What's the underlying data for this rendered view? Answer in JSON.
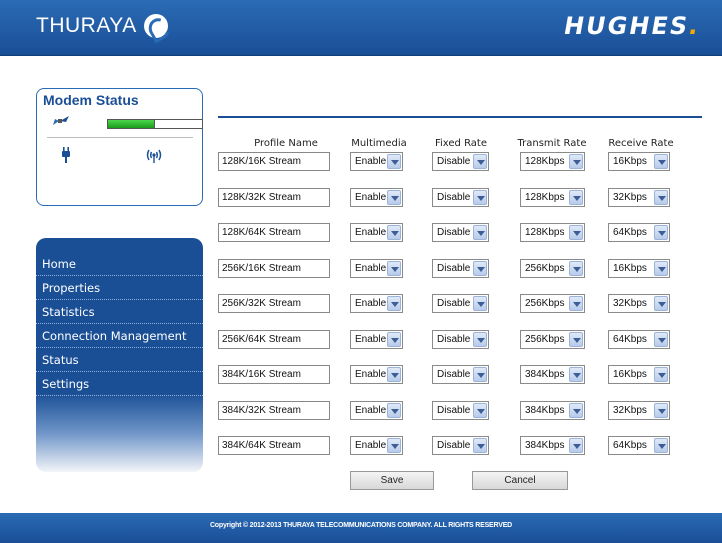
{
  "header": {
    "brand_left": "THURAYA",
    "brand_right": "HUGHES",
    "brand_right_dot": "."
  },
  "status_box": {
    "title": "Modem Status",
    "signal_level": 0.5
  },
  "nav": {
    "items": [
      "Home",
      "Properties",
      "Statistics",
      "Connection Management",
      "Status",
      "Settings"
    ]
  },
  "table": {
    "headers": [
      "Profile Name",
      "Multimedia",
      "Fixed Rate",
      "Transmit Rate",
      "Receive Rate"
    ],
    "rows": [
      {
        "profile": "128K/16K Stream",
        "multimedia": "Enable",
        "fixed": "Disable",
        "transmit": "128Kbps",
        "receive": "16Kbps"
      },
      {
        "profile": "128K/32K Stream",
        "multimedia": "Enable",
        "fixed": "Disable",
        "transmit": "128Kbps",
        "receive": "32Kbps"
      },
      {
        "profile": "128K/64K Stream",
        "multimedia": "Enable",
        "fixed": "Disable",
        "transmit": "128Kbps",
        "receive": "64Kbps"
      },
      {
        "profile": "256K/16K Stream",
        "multimedia": "Enable",
        "fixed": "Disable",
        "transmit": "256Kbps",
        "receive": "16Kbps"
      },
      {
        "profile": "256K/32K Stream",
        "multimedia": "Enable",
        "fixed": "Disable",
        "transmit": "256Kbps",
        "receive": "32Kbps"
      },
      {
        "profile": "256K/64K Stream",
        "multimedia": "Enable",
        "fixed": "Disable",
        "transmit": "256Kbps",
        "receive": "64Kbps"
      },
      {
        "profile": "384K/16K Stream",
        "multimedia": "Enable",
        "fixed": "Disable",
        "transmit": "384Kbps",
        "receive": "16Kbps"
      },
      {
        "profile": "384K/32K Stream",
        "multimedia": "Enable",
        "fixed": "Disable",
        "transmit": "384Kbps",
        "receive": "32Kbps"
      },
      {
        "profile": "384K/64K Stream",
        "multimedia": "Enable",
        "fixed": "Disable",
        "transmit": "384Kbps",
        "receive": "64Kbps"
      }
    ]
  },
  "buttons": {
    "save": "Save",
    "cancel": "Cancel"
  },
  "footer": {
    "copyright": "Copyright © 2012-2013 THURAYA TELECOMMUNICATIONS COMPANY. ALL RIGHTS RESERVED"
  },
  "colors": {
    "brand_blue": "#1a4f96",
    "accent_yellow": "#f2a900",
    "signal_green": "#2fb82f"
  }
}
